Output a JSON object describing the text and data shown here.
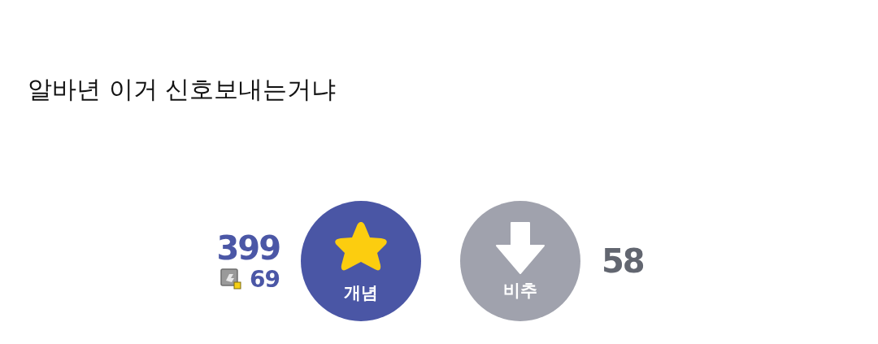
{
  "post": {
    "body": "알바년 이거 신호보내는거냐"
  },
  "votes": {
    "up_count": "399",
    "fixed_up_count": "69",
    "down_count": "58",
    "buttons": [
      {
        "kind": "up",
        "label": "개념"
      },
      {
        "kind": "down",
        "label": "비추"
      }
    ]
  }
}
